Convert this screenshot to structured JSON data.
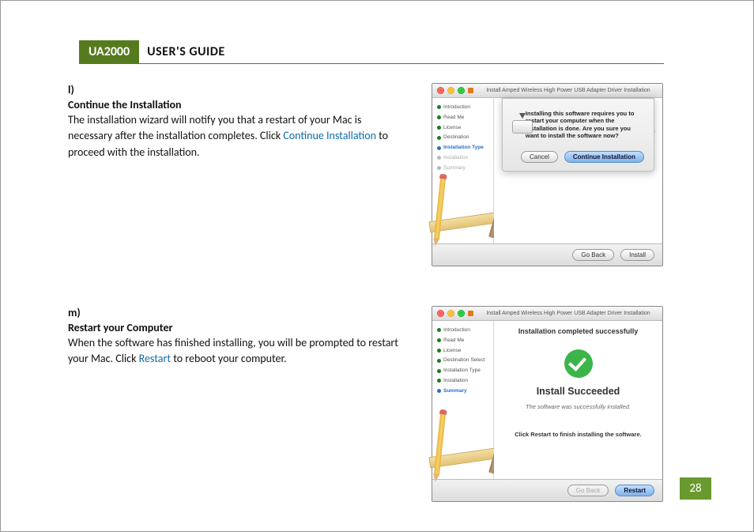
{
  "header": {
    "product": "UA2000",
    "title": "USER'S GUIDE"
  },
  "sections": [
    {
      "label": "l)",
      "heading": "Continue the Installation",
      "body_pre": "The installation wizard will notify you that a restart of your Mac is necessary after the installation completes. Click ",
      "body_link": "Continue Installation",
      "body_post": " to proceed with the installation."
    },
    {
      "label": "m)",
      "heading": "Restart your Computer",
      "body_pre": "When the software has finished installing, you will be prompted to restart your Mac. Click ",
      "body_link": "Restart",
      "body_post": " to reboot your computer."
    }
  ],
  "screenshot1": {
    "window_title": "Install Amped Wireless High Power USB Adapter Driver Installation",
    "steps": [
      "Introduction",
      "Read Me",
      "License",
      "Destination",
      "Installation Type",
      "Installation",
      "Summary"
    ],
    "step_current_index": 4,
    "dialog_msg": "Installing this software requires you to restart your computer when the installation is done. Are you sure you want to install the software now?",
    "btn_cancel": "Cancel",
    "btn_continue": "Continue Installation",
    "btn_goback": "Go Back",
    "btn_install": "Install",
    "behind_text": "er."
  },
  "screenshot2": {
    "window_title": "Install Amped Wireless High Power USB Adapter Driver Installation",
    "title": "Installation completed successfully",
    "steps": [
      "Introduction",
      "Read Me",
      "License",
      "Destination Select",
      "Installation Type",
      "Installation",
      "Summary"
    ],
    "step_current_index": 6,
    "success_heading": "Install Succeeded",
    "success_sub": "The software was successfully installed.",
    "success_hint": "Click Restart to finish installing the software.",
    "btn_goback": "Go Back",
    "btn_restart": "Restart"
  },
  "page_number": "28"
}
